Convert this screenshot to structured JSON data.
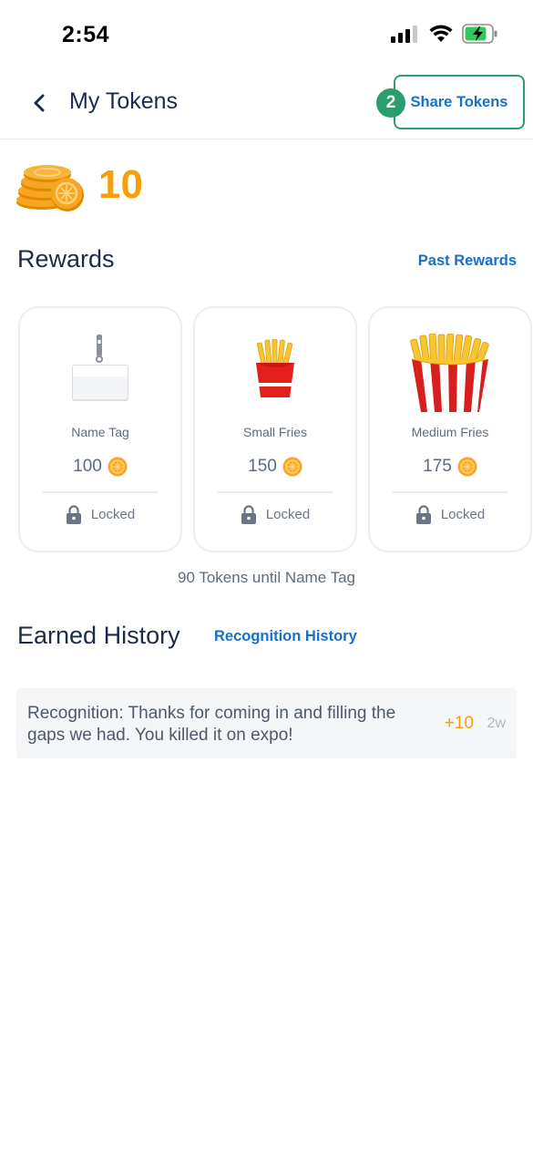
{
  "status_bar": {
    "time": "2:54",
    "icons": [
      "cellular-signal-icon",
      "wifi-icon",
      "battery-charging-icon"
    ]
  },
  "header": {
    "back_icon": "chevron-left-icon",
    "title": "My Tokens",
    "share_label": "Share Tokens",
    "step_badge": "2"
  },
  "balance": {
    "icon": "coin-stack-icon",
    "value": "10"
  },
  "rewards": {
    "title": "Rewards",
    "past_link": "Past Rewards",
    "items": [
      {
        "name": "Name Tag",
        "cost": "100",
        "status": "Locked",
        "image": "name-tag-image"
      },
      {
        "name": "Small Fries",
        "cost": "150",
        "status": "Locked",
        "image": "small-fries-image"
      },
      {
        "name": "Medium Fries",
        "cost": "175",
        "status": "Locked",
        "image": "medium-fries-image"
      }
    ],
    "until_text": "90 Tokens until Name Tag"
  },
  "earned": {
    "title": "Earned History",
    "recognition_link": "Recognition History",
    "items": [
      {
        "text": "Recognition:  Thanks for coming in and filling the gaps we had. You killed it on expo!",
        "points": "+10",
        "time": "2w"
      }
    ]
  },
  "colors": {
    "accent_orange": "#f5a00a",
    "link_blue": "#1a6fc8",
    "highlight_green": "#2a9d6c",
    "title_navy": "#1c2b4a"
  }
}
